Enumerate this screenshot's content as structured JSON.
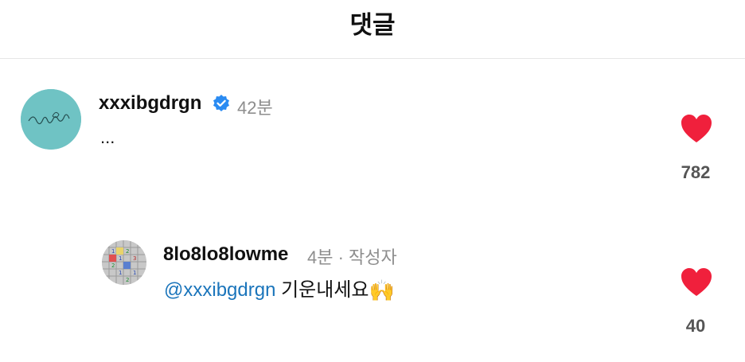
{
  "header": {
    "title": "댓글"
  },
  "comment": {
    "username": "xxxibgdrgn",
    "time": "42분",
    "text": "...",
    "like_count": "782",
    "avatar_icon": "profile-avatar-icon",
    "verified_icon": "verified-badge-icon",
    "heart_icon": "heart-filled-icon"
  },
  "reply": {
    "username": "8lo8lo8lowme",
    "meta": "4분 · 작성자",
    "mention": "@xxxibgdrgn",
    "text": " 기운내세요",
    "emoji": "🙌",
    "like_count": "40",
    "avatar_icon": "minesweeper-avatar-icon",
    "heart_icon": "heart-filled-icon"
  },
  "colors": {
    "heart": "#f0203c",
    "verified": "#2a8bf2",
    "mention": "#1b75bb",
    "avatar_bg": "#6fc3c4",
    "divider": "#e6e6e6"
  }
}
